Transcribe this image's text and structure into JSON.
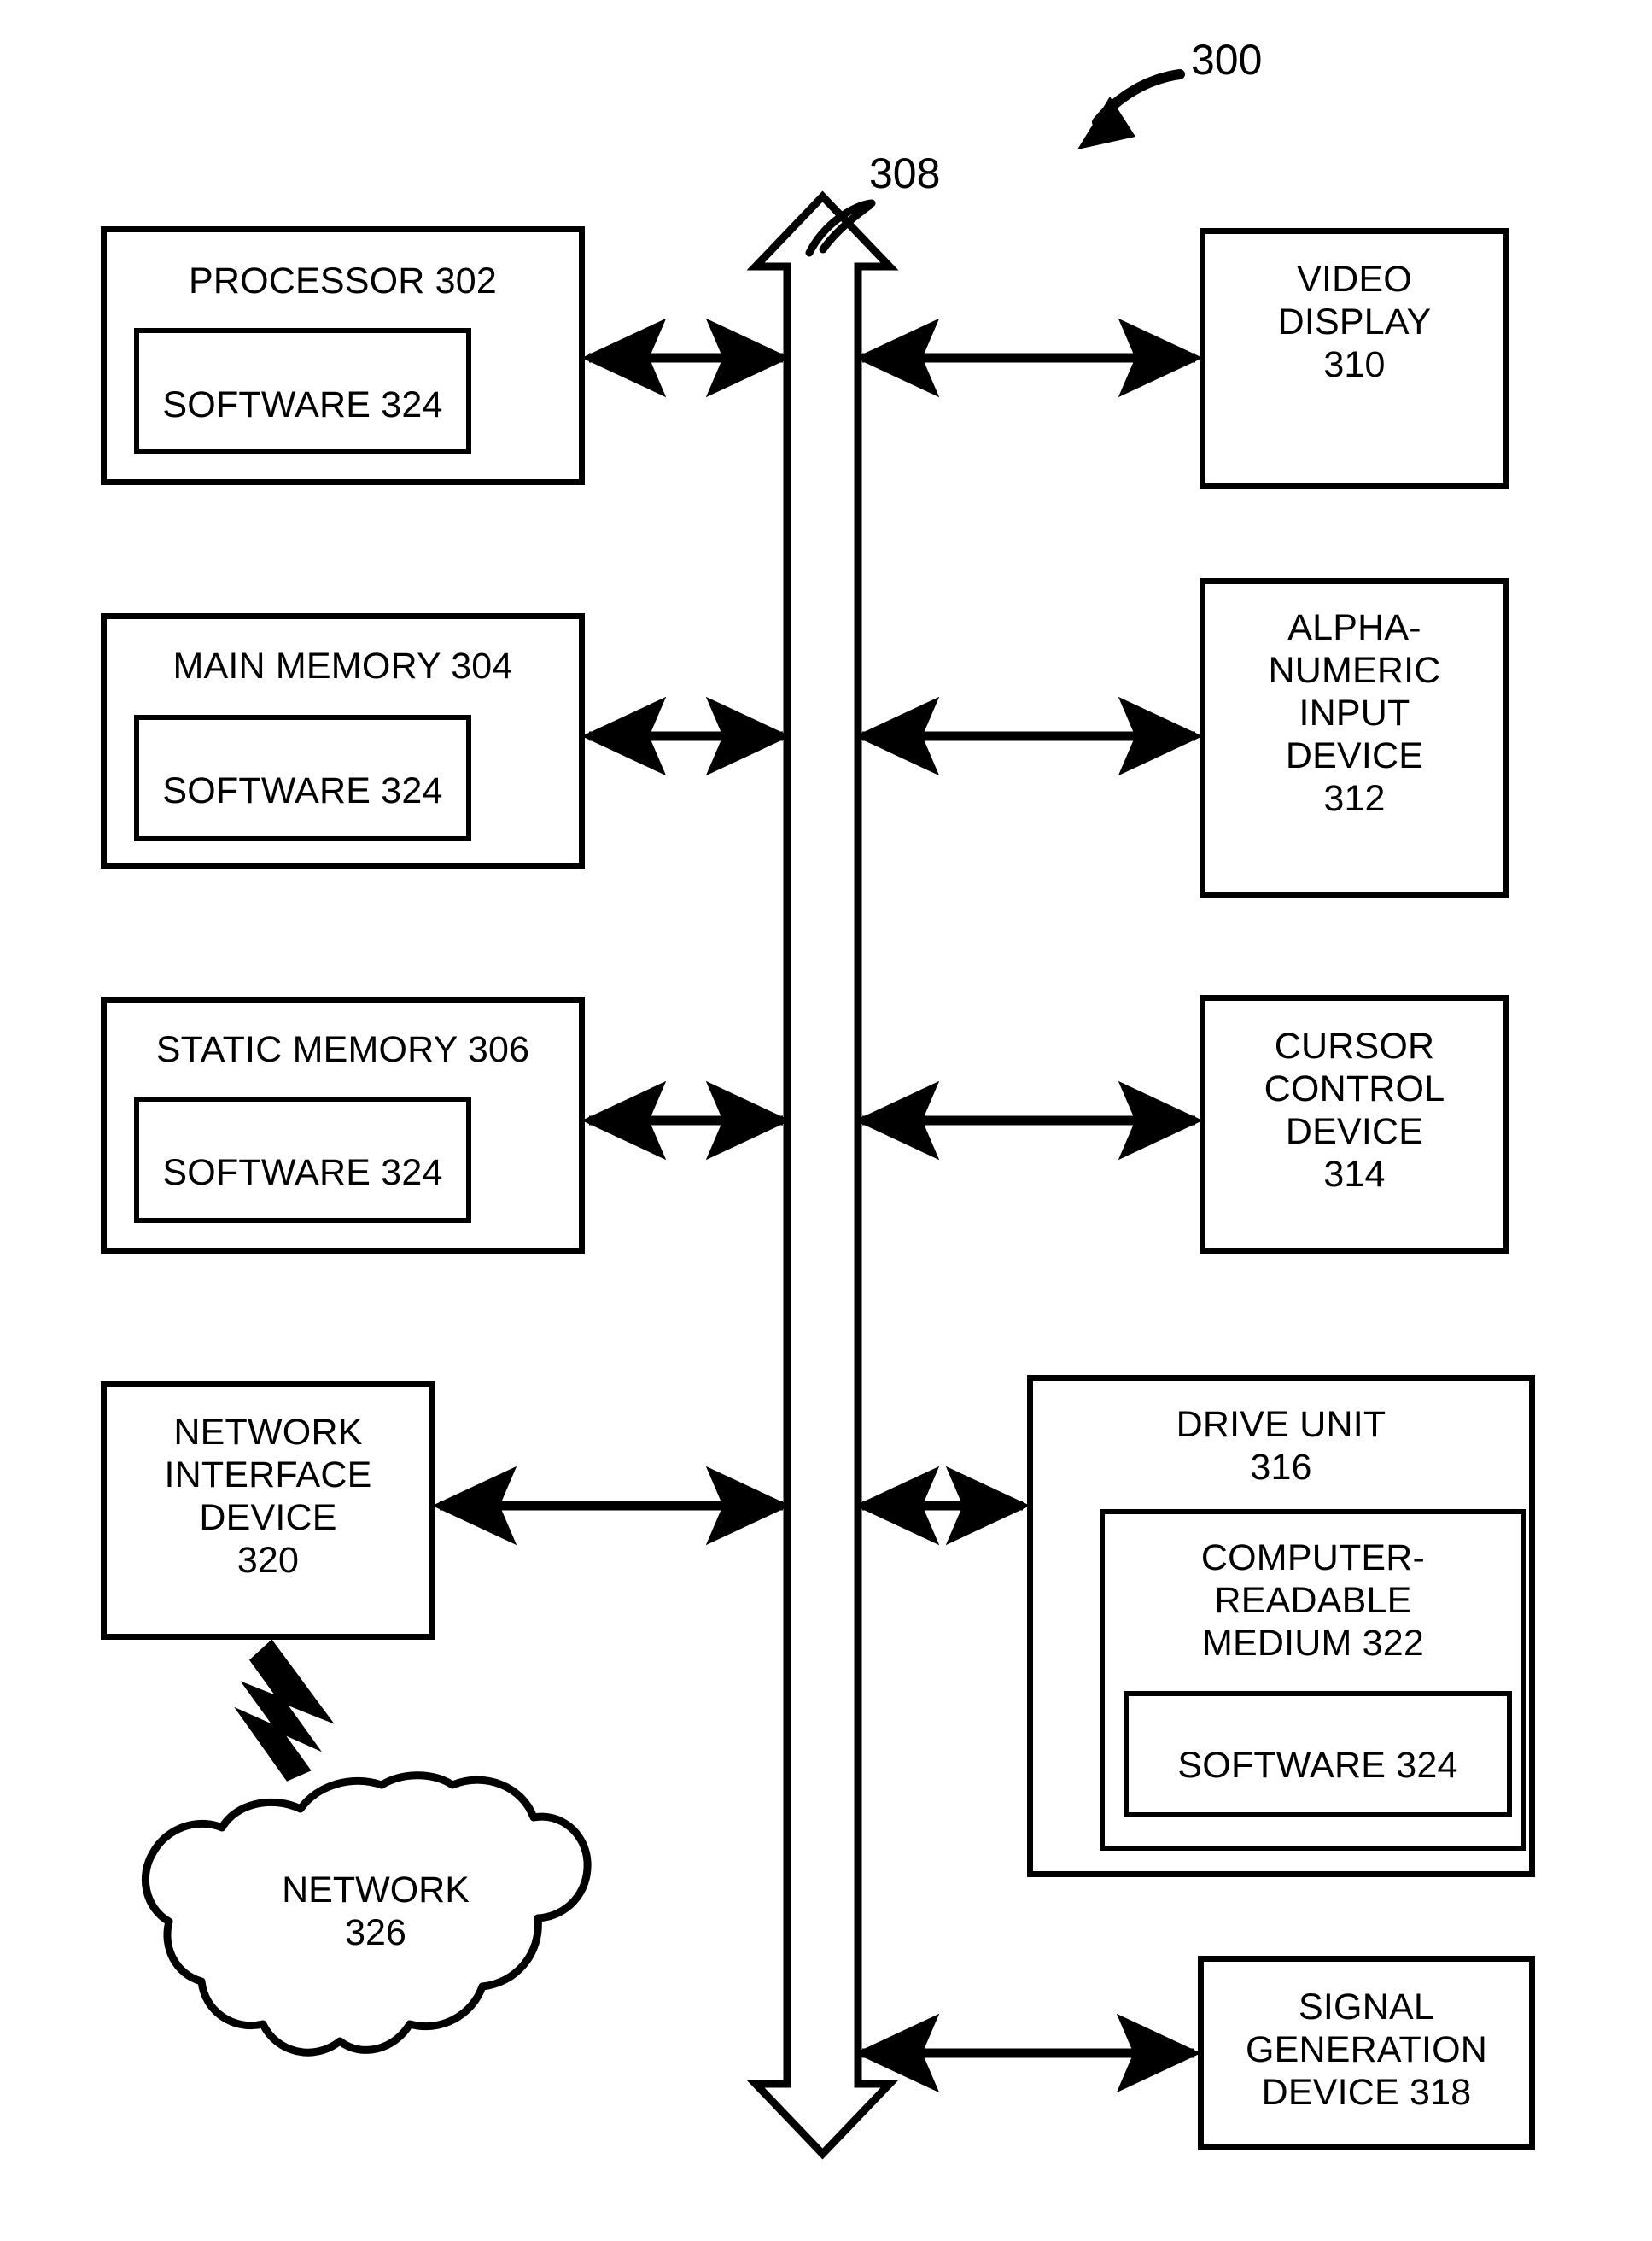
{
  "figure": {
    "reference_numeral": "300",
    "bus_numeral": "308"
  },
  "left_column": [
    {
      "id": "processor",
      "label": "PROCESSOR 302",
      "inner": {
        "id": "software-processor",
        "label": "SOFTWARE 324"
      }
    },
    {
      "id": "main-memory",
      "label": "MAIN MEMORY 304",
      "inner": {
        "id": "software-main-memory",
        "label": "SOFTWARE 324"
      }
    },
    {
      "id": "static-memory",
      "label": "STATIC MEMORY 306",
      "inner": {
        "id": "software-static-memory",
        "label": "SOFTWARE 324"
      }
    },
    {
      "id": "network-interface-device",
      "label": "NETWORK\nINTERFACE\nDEVICE\n320",
      "inner": null
    }
  ],
  "right_column": [
    {
      "id": "video-display",
      "label": "VIDEO\nDISPLAY\n310"
    },
    {
      "id": "alphanumeric-input-device",
      "label": "ALPHA-\nNUMERIC\nINPUT\nDEVICE\n312"
    },
    {
      "id": "cursor-control-device",
      "label": "CURSOR\nCONTROL\nDEVICE\n314"
    },
    {
      "id": "drive-unit",
      "label": "DRIVE UNIT\n316",
      "inner": {
        "id": "computer-readable-medium",
        "label": "COMPUTER-\nREADABLE\nMEDIUM 322",
        "inner": {
          "id": "software-drive-unit",
          "label": "SOFTWARE 324"
        }
      }
    },
    {
      "id": "signal-generation-device",
      "label": "SIGNAL\nGENERATION\nDEVICE 318"
    }
  ],
  "network_cloud": {
    "id": "network-cloud",
    "label": "NETWORK\n326"
  },
  "colors": {
    "stroke": "#000000",
    "fill": "#ffffff"
  }
}
